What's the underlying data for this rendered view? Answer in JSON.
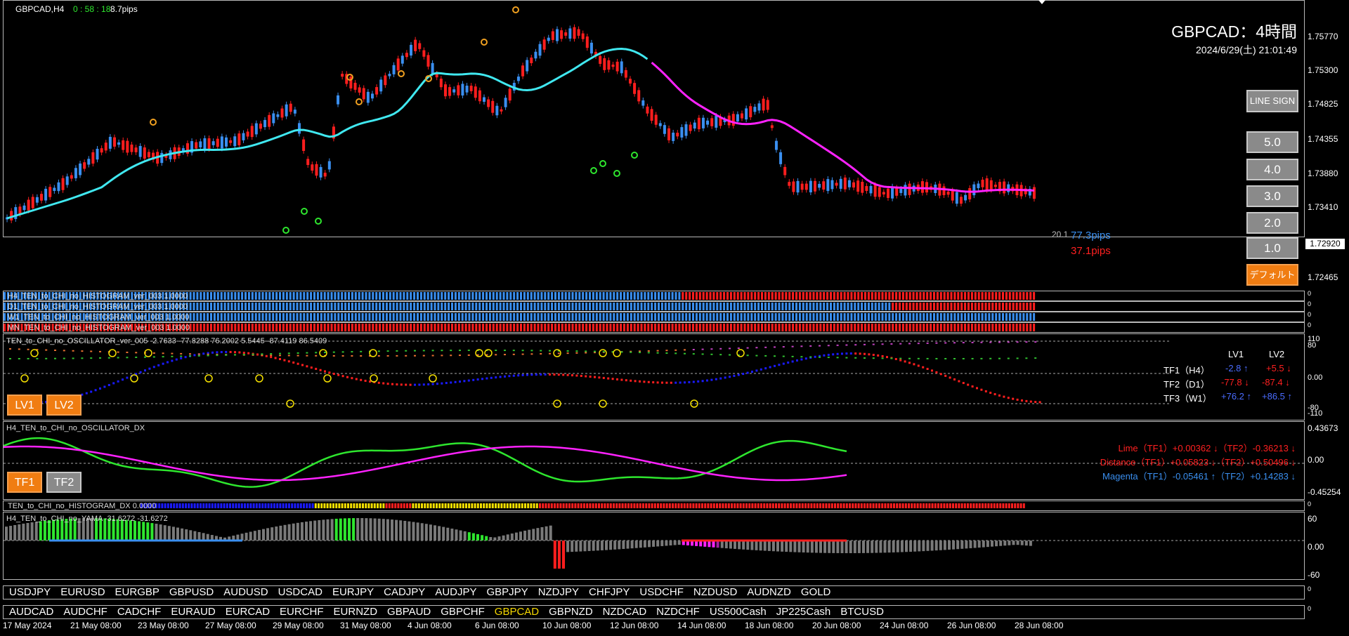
{
  "header": {
    "symbol_tf": "GBPCAD,H4",
    "countdown": "0 : 58 : 18",
    "spread": "8.7pips",
    "title": "GBPCAD：4時間",
    "datetime": "2024/6/29(土) 21:01:49"
  },
  "main_chart": {
    "price_ticks": [
      "1.75770",
      "1.75300",
      "1.74825",
      "1.74355",
      "1.73880",
      "1.73410",
      "1.72920",
      "1.72465"
    ],
    "current_price": "1.72920",
    "level_value": "20.1",
    "pips_up": "77.3pips",
    "pips_down": "37.1pips",
    "colors": {
      "bull": "#3a8ff0",
      "bear": "#ff1e1e",
      "ma_fast": "#ff22ff",
      "ma_slow": "#40e8f0"
    }
  },
  "buttons": {
    "line_sign": "LINE SIGN",
    "levels": [
      "5.0",
      "4.0",
      "3.0",
      "2.0",
      "1.0"
    ],
    "default": "デフォルト",
    "lv1": "LV1",
    "lv2": "LV2",
    "tf1": "TF1",
    "tf2": "TF2"
  },
  "histograms": [
    {
      "label": "H4_TEN_to_CHI_no_HISTOGRAM_ver_003 1.0000",
      "scale": "0"
    },
    {
      "label": "D1_TEN_to_CHI_no_HISTOGRAM_ver_003 1.0000",
      "scale": "0"
    },
    {
      "label": "W1_TEN_to_CHI_no_HISTOGRAM_ver_003 1.0000",
      "scale": "0"
    },
    {
      "label": "MN_TEN_to_CHI_no_HISTOGRAM_ver_003 1.0000",
      "scale": "0"
    }
  ],
  "oscillator": {
    "label": "TEN_to_CHI_no_OSCILLATOR_ver_005 -2.7633 -77.8288 76.2002 5.5445 -87.4119 86.5409",
    "ticks": [
      "110",
      "80",
      "0.00",
      "-80",
      "-110"
    ],
    "table_header": [
      "LV1",
      "LV2"
    ],
    "rows": [
      {
        "name": "TF1（H4）",
        "lv1": "-2.8 ↑",
        "lv2": "+5.5 ↓"
      },
      {
        "name": "TF2（D1）",
        "lv1": "-77.8 ↓",
        "lv2": "-87.4 ↓"
      },
      {
        "name": "TF3（W1）",
        "lv1": "+76.2 ↑",
        "lv2": "+86.5 ↑"
      }
    ]
  },
  "dx": {
    "label": "H4_TEN_to_CHI_no_OSCILLATOR_DX",
    "ticks": [
      "0.43673",
      "0.00",
      "-0.45254"
    ],
    "lines": [
      {
        "text": "Lime（TF1）+0.00362 ↓（TF2）-0.36213 ↓",
        "color": "#ff2020"
      },
      {
        "text": "Distance（TF1）+0.05823 ↓（TF2）+0.50496 ↓",
        "color": "#ff2020"
      },
      {
        "text": "Magenta（TF1）-0.05461 ↑（TF2）+0.14283 ↓",
        "color": "#3a8ff0"
      }
    ]
  },
  "hist_dx": {
    "label": "TEN_to_CHI_no_HISTOGRAM_DX 0.0000",
    "scale": "0"
  },
  "yama": {
    "label": "H4_TEN_to_CHI_no_YAMA -31.6272 -31.6272",
    "ticks": [
      "60",
      "0.00",
      "-60"
    ]
  },
  "symbols_row1": [
    "USDJPY",
    "EURUSD",
    "EURGBP",
    "GBPUSD",
    "AUDUSD",
    "USDCAD",
    "EURJPY",
    "CADJPY",
    "AUDJPY",
    "GBPJPY",
    "NZDJPY",
    "CHFJPY",
    "USDCHF",
    "NZDUSD",
    "AUDNZD",
    "GOLD"
  ],
  "symbols_row2": [
    "AUDCAD",
    "AUDCHF",
    "CADCHF",
    "EURAUD",
    "EURCAD",
    "EURCHF",
    "EURNZD",
    "GBPAUD",
    "GBPCHF",
    "GBPCAD",
    "GBPNZD",
    "NZDCAD",
    "NZDCHF",
    "US500Cash",
    "JP225Cash",
    "BTCUSD"
  ],
  "active_symbol": "GBPCAD",
  "row_scale": "0",
  "dates": [
    "17 May 2024",
    "21 May 08:00",
    "23 May 08:00",
    "27 May 08:00",
    "29 May 08:00",
    "31 May 08:00",
    "4 Jun 08:00",
    "6 Jun 08:00",
    "10 Jun 08:00",
    "12 Jun 08:00",
    "14 Jun 08:00",
    "18 Jun 08:00",
    "20 Jun 08:00",
    "24 Jun 08:00",
    "26 Jun 08:00",
    "28 Jun 08:00"
  ]
}
